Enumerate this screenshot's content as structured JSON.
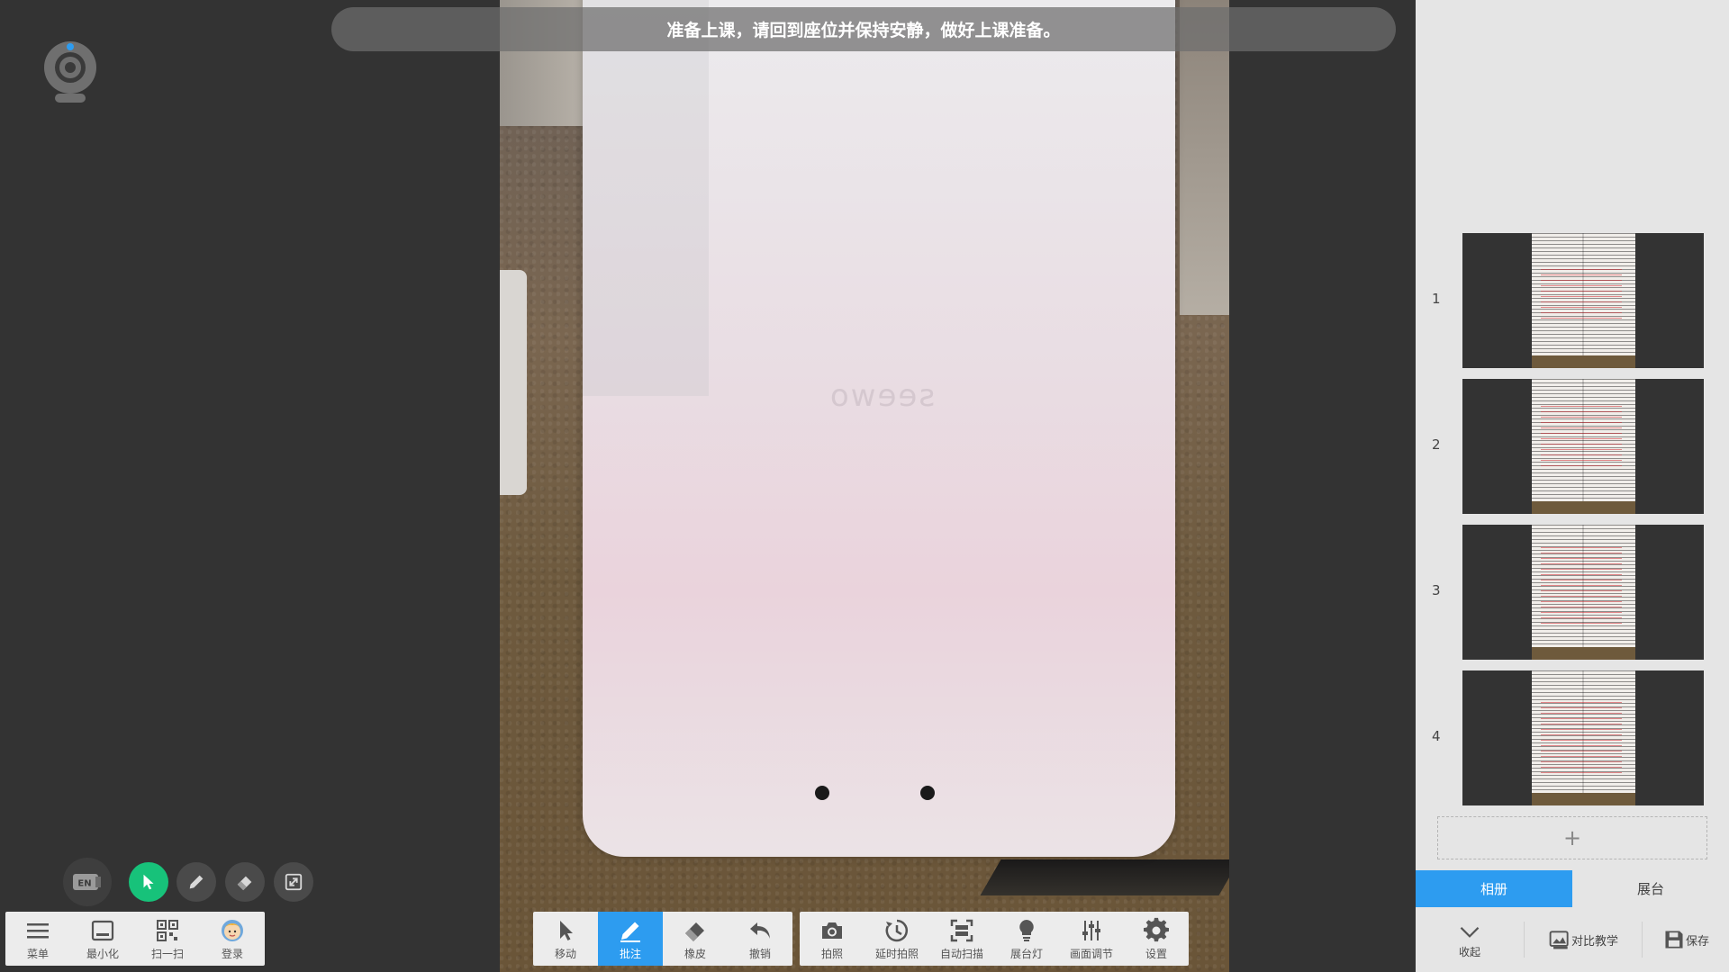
{
  "notice": {
    "text": "准备上课，请回到座位并保持安静，做好上课准备。"
  },
  "floating_tools": [
    {
      "id": "en",
      "icon": "en-keyboard-icon",
      "text": "EN"
    },
    {
      "id": "select",
      "icon": "cursor-icon"
    },
    {
      "id": "pen",
      "icon": "pen-icon"
    },
    {
      "id": "eraser",
      "icon": "eraser-icon"
    },
    {
      "id": "expand",
      "icon": "expand-icon"
    }
  ],
  "left_toolbar": [
    {
      "label": "菜单",
      "icon": "menu-icon"
    },
    {
      "label": "最小化",
      "icon": "minimize-icon"
    },
    {
      "label": "扫一扫",
      "icon": "qr-code-icon"
    },
    {
      "label": "登录",
      "icon": "avatar-icon"
    }
  ],
  "annot_toolbar": [
    {
      "label": "移动",
      "icon": "cursor-icon",
      "active": false
    },
    {
      "label": "批注",
      "icon": "pen-icon",
      "active": true
    },
    {
      "label": "橡皮",
      "icon": "eraser-icon",
      "active": false
    },
    {
      "label": "撤销",
      "icon": "undo-icon",
      "active": false
    }
  ],
  "camera_toolbar": [
    {
      "label": "拍照",
      "icon": "camera-icon"
    },
    {
      "label": "延时拍照",
      "icon": "timer-icon"
    },
    {
      "label": "自动扫描",
      "icon": "scan-icon"
    },
    {
      "label": "展台灯",
      "icon": "lightbulb-icon"
    },
    {
      "label": "画面调节",
      "icon": "sliders-icon"
    },
    {
      "label": "设置",
      "icon": "gear-icon"
    }
  ],
  "device_logo": "seewo",
  "album": {
    "thumbnails": [
      "1",
      "2",
      "3",
      "4"
    ],
    "add_symbol": "+"
  },
  "tabs": {
    "album": "相册",
    "booth": "展台"
  },
  "panel_bottom": {
    "collapse": "收起",
    "compare": "对比教学",
    "save": "保存"
  },
  "colors": {
    "accent": "#2d9cf0",
    "green": "#17c27a",
    "background": "#333333"
  }
}
